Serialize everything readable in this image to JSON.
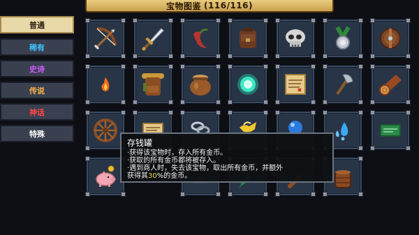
{
  "title": {
    "label": "宝物图鉴",
    "count": "(116/116)"
  },
  "tabs": [
    {
      "label": "普通",
      "color": "#2a2112",
      "active": true
    },
    {
      "label": "稀有",
      "color": "#3ec4ff",
      "active": false
    },
    {
      "label": "史诗",
      "color": "#cf5bff",
      "active": false
    },
    {
      "label": "传说",
      "color": "#ffb347",
      "active": false
    },
    {
      "label": "神话",
      "color": "#ff4545",
      "active": false
    },
    {
      "label": "特殊",
      "color": "#ffffff",
      "active": false
    }
  ],
  "items": [
    {
      "icon": "crossbow-icon"
    },
    {
      "icon": "sword-icon"
    },
    {
      "icon": "chili-pepper-icon"
    },
    {
      "icon": "leather-backpack-icon"
    },
    {
      "icon": "skull-icon"
    },
    {
      "icon": "medal-icon"
    },
    {
      "icon": "round-shield-icon"
    },
    {
      "icon": "small-flame-icon"
    },
    {
      "icon": "adventurer-backpack-icon"
    },
    {
      "icon": "clay-pot-icon"
    },
    {
      "icon": "glowing-orb-icon"
    },
    {
      "icon": "treasure-map-icon"
    },
    {
      "icon": "axe-icon"
    },
    {
      "icon": "wood-log-icon"
    },
    {
      "icon": "wagon-wheel-icon"
    },
    {
      "icon": "scroll-icon"
    },
    {
      "icon": "chain-icon"
    },
    {
      "icon": "magic-lamp-icon"
    },
    {
      "icon": "blue-bomb-icon"
    },
    {
      "icon": "water-drops-icon"
    },
    {
      "icon": "green-card-icon"
    },
    {
      "icon": "piggy-bank-icon"
    },
    {
      "icon": "dark-gem-icon"
    },
    {
      "icon": "green-feather-icon"
    },
    {
      "icon": "wooden-club-icon"
    },
    {
      "icon": "leather-barrel-icon"
    }
  ],
  "tooltip": {
    "title": "存钱罐",
    "line1": "·获得该宝物时，存入所有金币。",
    "line2": "·获取的所有金币都将被存入。",
    "line3": "·遇到商人时，失去该宝物，取出所有金币，并额外",
    "line4_prefix": "获得其",
    "line4_highlight": "30",
    "line4_suffix": "%的金币。"
  },
  "colors": {
    "highlight": "#f3d63a",
    "panel": "#283547",
    "banner": "#dcb865"
  }
}
